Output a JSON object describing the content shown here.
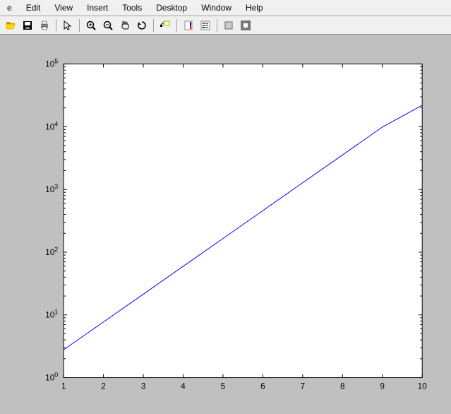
{
  "menu": {
    "items": [
      "e",
      "Edit",
      "View",
      "Insert",
      "Tools",
      "Desktop",
      "Window",
      "Help"
    ]
  },
  "toolbar": {
    "icons": [
      "open-icon",
      "save-icon",
      "print-icon",
      "sep",
      "pointer-icon",
      "sep",
      "zoom-in-icon",
      "zoom-out-icon",
      "pan-icon",
      "rotate-icon",
      "sep",
      "data-cursor-icon",
      "sep",
      "colorbar-icon",
      "legend-icon",
      "sep",
      "hide-tools-icon",
      "show-tools-icon"
    ]
  },
  "chart_data": {
    "type": "line",
    "x": [
      1,
      2,
      3,
      4,
      5,
      6,
      7,
      8,
      9,
      10
    ],
    "y": [
      2.78,
      7.72,
      21.4,
      59.6,
      165,
      460,
      1280,
      3550,
      9870,
      22000
    ],
    "title": "",
    "xlabel": "",
    "ylabel": "",
    "xlim": [
      1,
      10
    ],
    "ylim": [
      1,
      100000
    ],
    "yscale": "log",
    "xticks": [
      1,
      2,
      3,
      4,
      5,
      6,
      7,
      8,
      9,
      10
    ],
    "xtick_labels": [
      "1",
      "2",
      "3",
      "4",
      "5",
      "6",
      "7",
      "8",
      "9",
      "10"
    ],
    "yticks": [
      1,
      10,
      100,
      1000,
      10000,
      100000
    ],
    "ytick_labels_base": "10",
    "ytick_labels_exp": [
      "0",
      "1",
      "2",
      "3",
      "4",
      "5"
    ]
  }
}
